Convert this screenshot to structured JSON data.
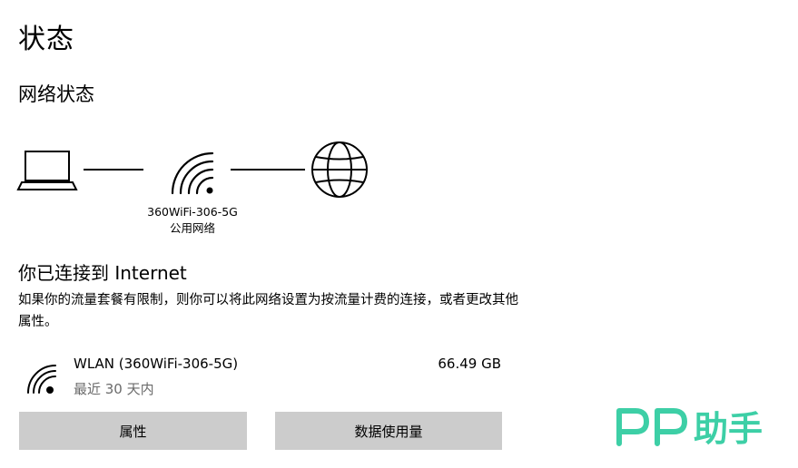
{
  "page": {
    "title": "状态"
  },
  "network_status": {
    "heading": "网络状态",
    "network_name": "360WiFi-306-5G",
    "network_type": "公用网络"
  },
  "connection": {
    "title": "你已连接到 Internet",
    "description": "如果你的流量套餐有限制，则你可以将此网络设置为按流量计费的连接，或者更改其他属性。"
  },
  "adapter": {
    "name": "WLAN (360WiFi-306-5G)",
    "period": "最近 30 天内",
    "usage": "66.49 GB",
    "icon": "wifi-icon"
  },
  "buttons": {
    "properties": "属性",
    "data_usage": "数据使用量"
  },
  "watermark": {
    "text": "PP助手",
    "color": "#3dcfa6"
  },
  "colors": {
    "button_bg": "#cccccc",
    "secondary_text": "#6b6b6b"
  }
}
